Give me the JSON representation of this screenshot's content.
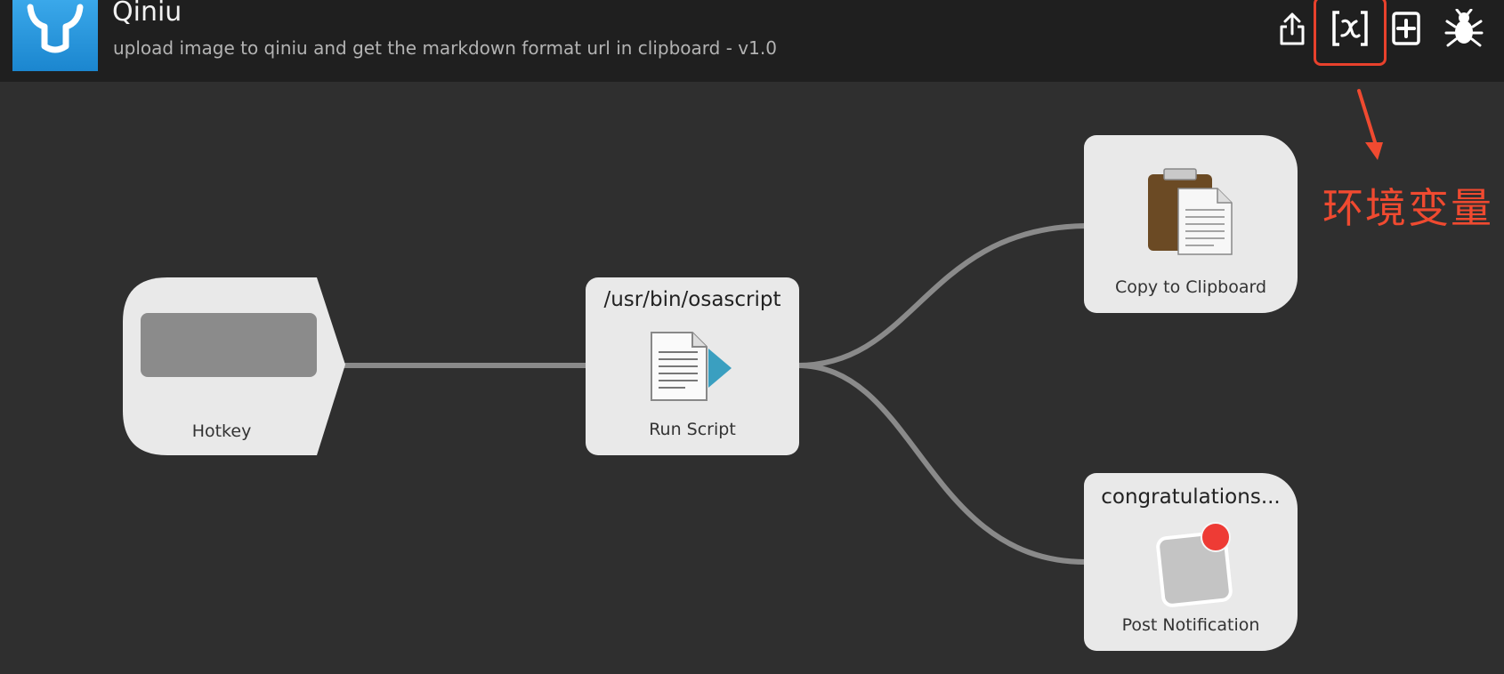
{
  "workflow": {
    "title": "Qiniu",
    "subtitle": "upload image to qiniu and get the markdown format url in clipboard - v1.0"
  },
  "toolbar": {
    "items": [
      {
        "name": "share-icon"
      },
      {
        "name": "variables-icon",
        "label": "[x]"
      },
      {
        "name": "add-icon"
      },
      {
        "name": "debug-bug-icon"
      }
    ]
  },
  "annotation": {
    "text": "环境变量",
    "color": "#f04a30"
  },
  "nodes": {
    "hotkey": {
      "label": "Hotkey"
    },
    "run_script": {
      "title": "/usr/bin/osascript",
      "label": "Run Script"
    },
    "clipboard": {
      "label": "Copy to Clipboard"
    },
    "notification": {
      "title": "congratulations...",
      "label": "Post Notification"
    }
  },
  "colors": {
    "header_bg": "#1f1f1f",
    "canvas_bg": "#2f2f2f",
    "node_bg": "#e9e9e9",
    "connector": "#8a8a8a",
    "highlight": "#e8412c"
  }
}
